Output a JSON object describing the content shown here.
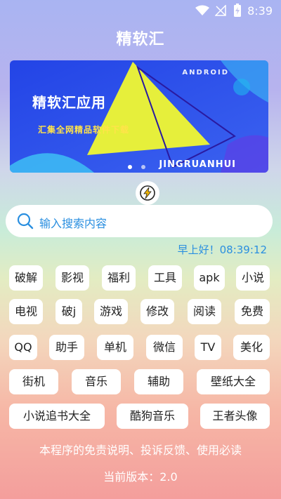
{
  "status_bar": {
    "time": "8:39"
  },
  "header": {
    "title": "精软汇"
  },
  "banner": {
    "title": "精软汇应用",
    "subtitle": "汇集全网精品软件下载",
    "brand_en": "JINGRUANHUI",
    "tag_en": "ANDROID"
  },
  "search": {
    "placeholder": "输入搜索内容"
  },
  "greeting": "早上好！08:39:12",
  "categories": [
    [
      "破解",
      "影视",
      "福利",
      "工具",
      "apk",
      "小说"
    ],
    [
      "电视",
      "破j",
      "游戏",
      "修改",
      "阅读",
      "免费"
    ],
    [
      "QQ",
      "助手",
      "单机",
      "微信",
      "TV",
      "美化"
    ],
    [
      "街机",
      "音乐",
      "辅助",
      "壁纸大全"
    ],
    [
      "小说追书大全",
      "酷狗音乐",
      "王者头像"
    ]
  ],
  "footer": {
    "notice": "本程序的免责说明、投诉反馈、使用必读",
    "version": "当前版本：2.0"
  },
  "colors": {
    "accent": "#2a8fe0",
    "banner_bg": "#2b4fe6",
    "triangle": "#e6ef3b"
  }
}
